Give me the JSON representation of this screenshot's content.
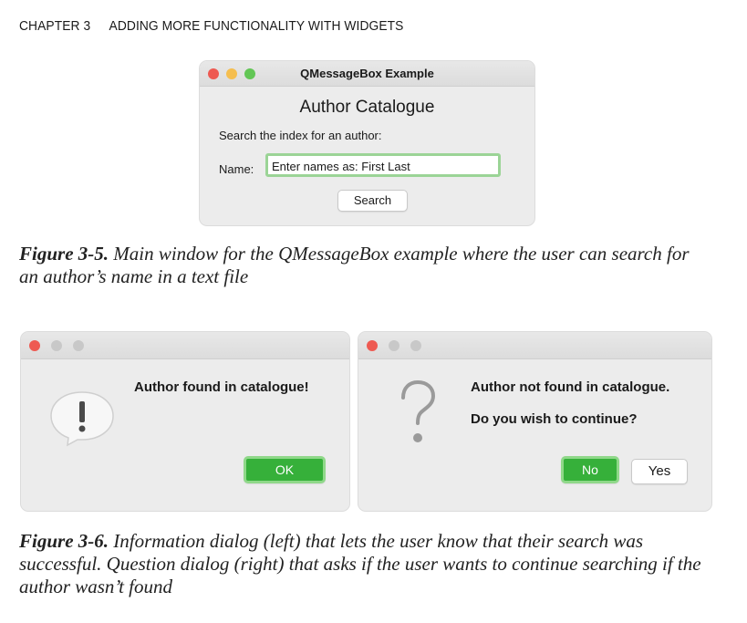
{
  "header": {
    "chapter": "CHAPTER 3",
    "title": "ADDING MORE FUNCTIONALITY WITH WIDGETS"
  },
  "window1": {
    "title": "QMessageBox Example",
    "heading": "Author Catalogue",
    "instruction": "Search the index for an author:",
    "name_label": "Name:",
    "name_value": "Enter names as: First Last",
    "search_button": "Search"
  },
  "caption1": {
    "fig": "Figure 3-5.",
    "text": "Main window for the QMessageBox example where the user can search for an author’s name in a text file"
  },
  "dialog_info": {
    "message": "Author found in catalogue!",
    "ok_button": "OK",
    "icon": "exclamation-speech-bubble-icon"
  },
  "dialog_question": {
    "message": "Author not found in catalogue.",
    "question": "Do you wish to continue?",
    "no_button": "No",
    "yes_button": "Yes",
    "icon": "question-mark-icon"
  },
  "caption2": {
    "fig": "Figure 3-6.",
    "text": "Information dialog (left) that lets the user know that their search was successful. Question dialog (right) that asks if the user wants to continue searching if the author wasn’t found"
  },
  "colors": {
    "accent_green": "#36b03a",
    "focus_ring": "#9bd496",
    "close_red": "#ee5a52",
    "minimize_yellow": "#f5be4f",
    "zoom_green": "#62c655"
  }
}
